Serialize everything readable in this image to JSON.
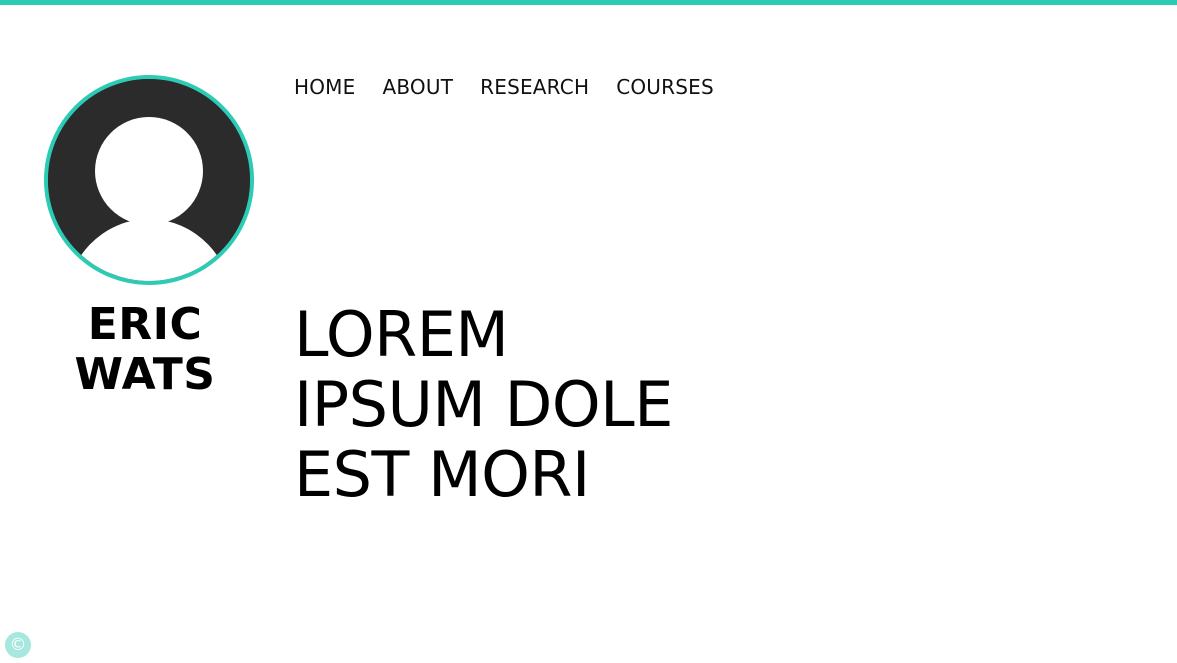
{
  "theme": {
    "accent": "#2ccbb4",
    "avatar_bg": "#2b2b2b",
    "badge_bg": "#a6e8dd"
  },
  "author": {
    "name_line1": "ERIC",
    "name_line2": "WATS"
  },
  "nav": {
    "items": [
      {
        "label": "HOME"
      },
      {
        "label": "ABOUT"
      },
      {
        "label": "RESEARCH"
      },
      {
        "label": "COURSES"
      }
    ]
  },
  "hero": {
    "line1": "LOREM",
    "line2": "IPSUM DOLE",
    "line3": "EST MORI"
  },
  "footer": {
    "badge_symbol": "©",
    "badge_icon": "copyright-icon"
  }
}
